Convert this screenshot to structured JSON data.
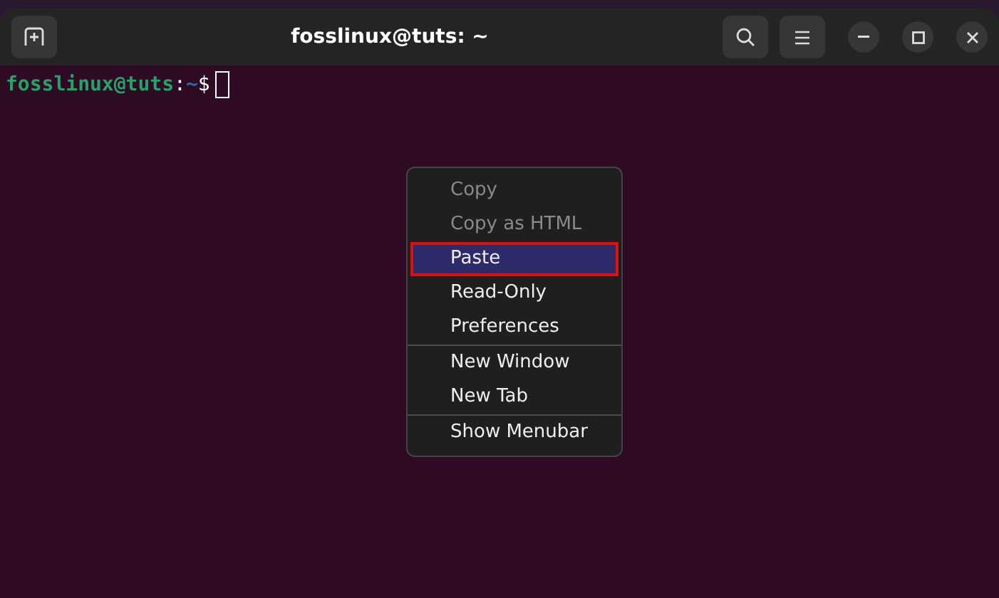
{
  "window": {
    "title": "fosslinux@tuts: ~"
  },
  "prompt": {
    "user_host": "fosslinux@tuts",
    "separator": ":",
    "path": "~",
    "symbol": "$"
  },
  "context_menu": {
    "items": [
      {
        "label": "Copy",
        "disabled": true,
        "selected": false,
        "separator_after": false
      },
      {
        "label": "Copy as HTML",
        "disabled": true,
        "selected": false,
        "separator_after": false
      },
      {
        "label": "Paste",
        "disabled": false,
        "selected": true,
        "separator_after": false
      },
      {
        "label": "Read-Only",
        "disabled": false,
        "selected": false,
        "separator_after": false
      },
      {
        "label": "Preferences",
        "disabled": false,
        "selected": false,
        "separator_after": true
      },
      {
        "label": "New Window",
        "disabled": false,
        "selected": false,
        "separator_after": false
      },
      {
        "label": "New Tab",
        "disabled": false,
        "selected": false,
        "separator_after": true
      },
      {
        "label": "Show Menubar",
        "disabled": false,
        "selected": false,
        "separator_after": false
      }
    ]
  }
}
